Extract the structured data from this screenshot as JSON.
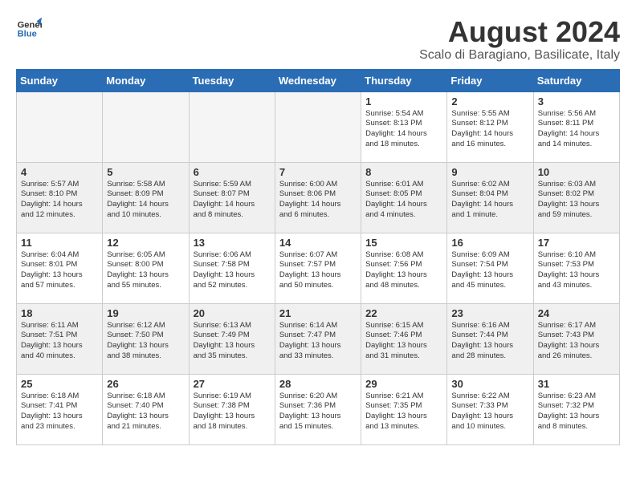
{
  "logo": {
    "line1": "General",
    "line2": "Blue"
  },
  "title": "August 2024",
  "subtitle": "Scalo di Baragiano, Basilicate, Italy",
  "days": [
    "Sunday",
    "Monday",
    "Tuesday",
    "Wednesday",
    "Thursday",
    "Friday",
    "Saturday"
  ],
  "weeks": [
    [
      {
        "day": "",
        "content": ""
      },
      {
        "day": "",
        "content": ""
      },
      {
        "day": "",
        "content": ""
      },
      {
        "day": "",
        "content": ""
      },
      {
        "day": "1",
        "content": "Sunrise: 5:54 AM\nSunset: 8:13 PM\nDaylight: 14 hours\nand 18 minutes."
      },
      {
        "day": "2",
        "content": "Sunrise: 5:55 AM\nSunset: 8:12 PM\nDaylight: 14 hours\nand 16 minutes."
      },
      {
        "day": "3",
        "content": "Sunrise: 5:56 AM\nSunset: 8:11 PM\nDaylight: 14 hours\nand 14 minutes."
      }
    ],
    [
      {
        "day": "4",
        "content": "Sunrise: 5:57 AM\nSunset: 8:10 PM\nDaylight: 14 hours\nand 12 minutes."
      },
      {
        "day": "5",
        "content": "Sunrise: 5:58 AM\nSunset: 8:09 PM\nDaylight: 14 hours\nand 10 minutes."
      },
      {
        "day": "6",
        "content": "Sunrise: 5:59 AM\nSunset: 8:07 PM\nDaylight: 14 hours\nand 8 minutes."
      },
      {
        "day": "7",
        "content": "Sunrise: 6:00 AM\nSunset: 8:06 PM\nDaylight: 14 hours\nand 6 minutes."
      },
      {
        "day": "8",
        "content": "Sunrise: 6:01 AM\nSunset: 8:05 PM\nDaylight: 14 hours\nand 4 minutes."
      },
      {
        "day": "9",
        "content": "Sunrise: 6:02 AM\nSunset: 8:04 PM\nDaylight: 14 hours\nand 1 minute."
      },
      {
        "day": "10",
        "content": "Sunrise: 6:03 AM\nSunset: 8:02 PM\nDaylight: 13 hours\nand 59 minutes."
      }
    ],
    [
      {
        "day": "11",
        "content": "Sunrise: 6:04 AM\nSunset: 8:01 PM\nDaylight: 13 hours\nand 57 minutes."
      },
      {
        "day": "12",
        "content": "Sunrise: 6:05 AM\nSunset: 8:00 PM\nDaylight: 13 hours\nand 55 minutes."
      },
      {
        "day": "13",
        "content": "Sunrise: 6:06 AM\nSunset: 7:58 PM\nDaylight: 13 hours\nand 52 minutes."
      },
      {
        "day": "14",
        "content": "Sunrise: 6:07 AM\nSunset: 7:57 PM\nDaylight: 13 hours\nand 50 minutes."
      },
      {
        "day": "15",
        "content": "Sunrise: 6:08 AM\nSunset: 7:56 PM\nDaylight: 13 hours\nand 48 minutes."
      },
      {
        "day": "16",
        "content": "Sunrise: 6:09 AM\nSunset: 7:54 PM\nDaylight: 13 hours\nand 45 minutes."
      },
      {
        "day": "17",
        "content": "Sunrise: 6:10 AM\nSunset: 7:53 PM\nDaylight: 13 hours\nand 43 minutes."
      }
    ],
    [
      {
        "day": "18",
        "content": "Sunrise: 6:11 AM\nSunset: 7:51 PM\nDaylight: 13 hours\nand 40 minutes."
      },
      {
        "day": "19",
        "content": "Sunrise: 6:12 AM\nSunset: 7:50 PM\nDaylight: 13 hours\nand 38 minutes."
      },
      {
        "day": "20",
        "content": "Sunrise: 6:13 AM\nSunset: 7:49 PM\nDaylight: 13 hours\nand 35 minutes."
      },
      {
        "day": "21",
        "content": "Sunrise: 6:14 AM\nSunset: 7:47 PM\nDaylight: 13 hours\nand 33 minutes."
      },
      {
        "day": "22",
        "content": "Sunrise: 6:15 AM\nSunset: 7:46 PM\nDaylight: 13 hours\nand 31 minutes."
      },
      {
        "day": "23",
        "content": "Sunrise: 6:16 AM\nSunset: 7:44 PM\nDaylight: 13 hours\nand 28 minutes."
      },
      {
        "day": "24",
        "content": "Sunrise: 6:17 AM\nSunset: 7:43 PM\nDaylight: 13 hours\nand 26 minutes."
      }
    ],
    [
      {
        "day": "25",
        "content": "Sunrise: 6:18 AM\nSunset: 7:41 PM\nDaylight: 13 hours\nand 23 minutes."
      },
      {
        "day": "26",
        "content": "Sunrise: 6:18 AM\nSunset: 7:40 PM\nDaylight: 13 hours\nand 21 minutes."
      },
      {
        "day": "27",
        "content": "Sunrise: 6:19 AM\nSunset: 7:38 PM\nDaylight: 13 hours\nand 18 minutes."
      },
      {
        "day": "28",
        "content": "Sunrise: 6:20 AM\nSunset: 7:36 PM\nDaylight: 13 hours\nand 15 minutes."
      },
      {
        "day": "29",
        "content": "Sunrise: 6:21 AM\nSunset: 7:35 PM\nDaylight: 13 hours\nand 13 minutes."
      },
      {
        "day": "30",
        "content": "Sunrise: 6:22 AM\nSunset: 7:33 PM\nDaylight: 13 hours\nand 10 minutes."
      },
      {
        "day": "31",
        "content": "Sunrise: 6:23 AM\nSunset: 7:32 PM\nDaylight: 13 hours\nand 8 minutes."
      }
    ]
  ]
}
